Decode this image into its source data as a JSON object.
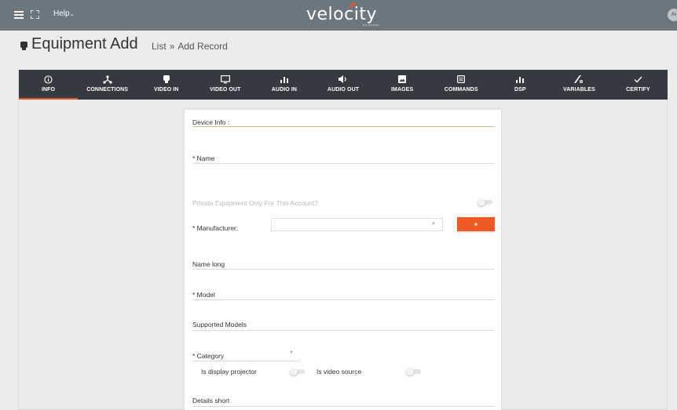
{
  "topbar": {
    "help_label": "Help",
    "logo_text": "velocity",
    "logo_sub": "by Atlona",
    "avatar_text": "Ai"
  },
  "header": {
    "title": "Equipment Add",
    "breadcrumb": [
      "List",
      "»",
      "Add Record"
    ]
  },
  "tabs": [
    {
      "label": "INFO",
      "icon": "info-icon",
      "active": true
    },
    {
      "label": "CONNECTIONS",
      "icon": "connections-icon"
    },
    {
      "label": "VIDEO IN",
      "icon": "video-in-icon"
    },
    {
      "label": "VIDEO OUT",
      "icon": "monitor-icon"
    },
    {
      "label": "AUDIO IN",
      "icon": "bars-icon"
    },
    {
      "label": "AUDIO OUT",
      "icon": "speaker-icon"
    },
    {
      "label": "IMAGES",
      "icon": "image-icon"
    },
    {
      "label": "COMMANDS",
      "icon": "commands-icon"
    },
    {
      "label": "DSP",
      "icon": "bars-icon"
    },
    {
      "label": "VARIABLES",
      "icon": "variables-icon"
    },
    {
      "label": "CERTIFY",
      "icon": "check-icon"
    }
  ],
  "form": {
    "section_title": "Device Info :",
    "name_label": "* Name",
    "private_label": "Private Equipment Only For This Account?",
    "manufacturer_label": "* Manufacturer:",
    "manufacturer_value": "",
    "add_button": "+",
    "name_long_label": "Name long",
    "model_label": "* Model",
    "supported_models_label": "Supported Models",
    "category_label": "* Category",
    "display_projector_label": "Is display projector",
    "video_source_label": "Is video source",
    "details_short_label": "Details short"
  },
  "colors": {
    "topbar": "#6c767f",
    "tabbar": "#343a3f",
    "accent": "#e5572a"
  }
}
